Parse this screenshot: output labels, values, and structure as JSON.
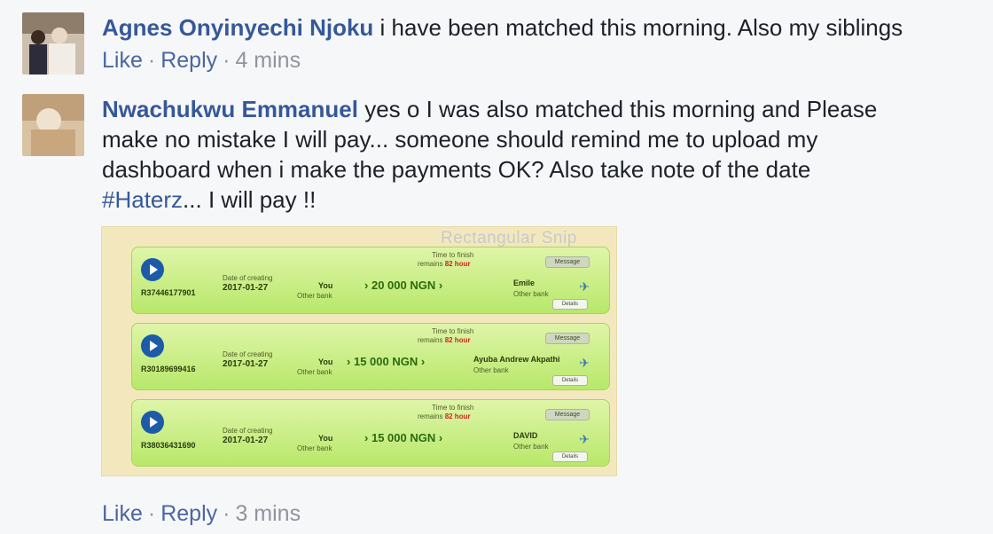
{
  "comments": [
    {
      "author": "Agnes Onyinyechi Njoku",
      "text": "i have been matched this morning. Also my siblings",
      "like_label": "Like",
      "reply_label": "Reply",
      "time": "4 mins"
    },
    {
      "author": "Nwachukwu Emmanuel",
      "text_line1": "yes o I was also matched this morning and Please",
      "text_line2": "make no mistake I will pay... someone should remind me to upload my",
      "text_line3": "dashboard when i make the payments OK? Also take note of the date",
      "hashtag": "#Haterz",
      "text_line4_rest": "... I will pay !!",
      "like_label": "Like",
      "reply_label": "Reply",
      "time": "3 mins"
    }
  ],
  "snip_watermark": "Rectangular Snip",
  "attachment_rows": [
    {
      "order": "R37446177901",
      "date": "2017-01-27",
      "you": "You",
      "amount": "20 000 NGN",
      "recipient": "Emile",
      "time_to_finish": "Time to finish",
      "remains": "remains",
      "hours": "82 hour",
      "date_label": "Date of creating",
      "other_bank": "Other bank",
      "details_btn": "Message",
      "status_btn": "Details"
    },
    {
      "order": "R30189699416",
      "date": "2017-01-27",
      "you": "You",
      "amount": "15 000 NGN",
      "recipient": "Ayuba Andrew Akpathi",
      "time_to_finish": "Time to finish",
      "remains": "remains",
      "hours": "82 hour",
      "date_label": "Date of creating",
      "other_bank": "Other bank",
      "details_btn": "Message",
      "status_btn": "Details"
    },
    {
      "order": "R38036431690",
      "date": "2017-01-27",
      "you": "You",
      "amount": "15 000 NGN",
      "recipient": "DAVID",
      "time_to_finish": "Time to finish",
      "remains": "remains",
      "hours": "82 hour",
      "date_label": "Date of creating",
      "other_bank": "Other bank",
      "details_btn": "Message",
      "status_btn": "Details"
    }
  ],
  "colors": {
    "author_link": "#365899",
    "muted": "#90949c",
    "row_green": "#b8e86a",
    "attachment_bg": "#f3e8bd"
  },
  "icons": [
    "avatar",
    "play-icon",
    "plane-icon",
    "arrow-icon"
  ]
}
